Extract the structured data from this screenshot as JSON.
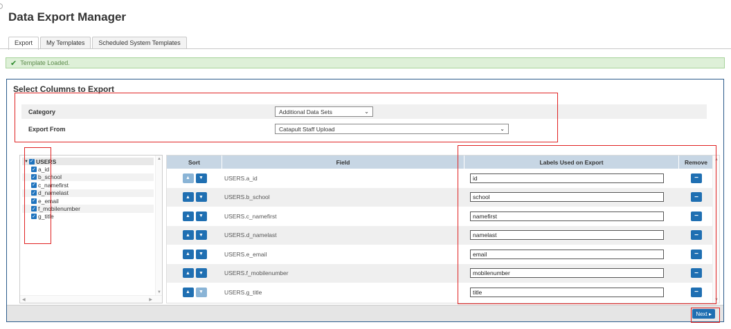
{
  "page_title": "Data Export Manager",
  "tabs": [
    {
      "label": "Export",
      "active": true
    },
    {
      "label": "My Templates",
      "active": false
    },
    {
      "label": "Scheduled System Templates",
      "active": false
    }
  ],
  "alert": {
    "text": "Template Loaded.",
    "icon": "check-icon",
    "color": "#def0d8"
  },
  "panel": {
    "title": "Select Columns to Export",
    "category": {
      "label": "Category",
      "value": "Additional Data Sets"
    },
    "export_from": {
      "label": "Export From",
      "value": "Catapult Staff Upload"
    }
  },
  "tree": {
    "root": "USERS",
    "items": [
      "a_id",
      "b_school",
      "c_namefirst",
      "d_namelast",
      "e_email",
      "f_mobilenumber",
      "g_title"
    ]
  },
  "grid": {
    "headers": {
      "sort": "Sort",
      "field": "Field",
      "label": "Labels Used on Export",
      "remove": "Remove"
    },
    "rows": [
      {
        "field": "USERS.a_id",
        "label": "id"
      },
      {
        "field": "USERS.b_school",
        "label": "school"
      },
      {
        "field": "USERS.c_namefirst",
        "label": "namefirst"
      },
      {
        "field": "USERS.d_namelast",
        "label": "namelast"
      },
      {
        "field": "USERS.e_email",
        "label": "email"
      },
      {
        "field": "USERS.f_mobilenumber",
        "label": "mobilenumber"
      },
      {
        "field": "USERS.g_title",
        "label": "title"
      }
    ]
  },
  "footer": {
    "next_label": "Next ▸"
  },
  "colors": {
    "accent": "#1f6fb2",
    "highlight": "#e02020",
    "header_bg": "#c7d6e4"
  }
}
